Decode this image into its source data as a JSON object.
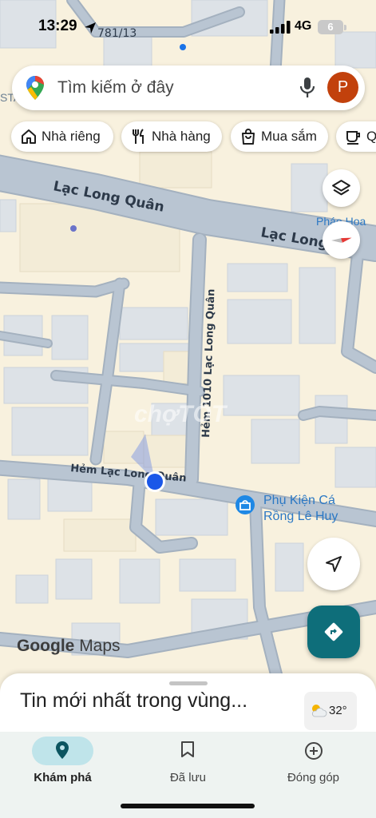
{
  "status_bar": {
    "time": "13:29",
    "network": "4G",
    "battery": "6"
  },
  "map": {
    "labels": {
      "street_top": "781/13",
      "road_main_left": "Lạc Long Quân",
      "road_main_right": "Lạc Long",
      "poi_top": "Pháo Hoa",
      "alley_vertical": "Hẻm 1010 Lạc Long Quân",
      "alley_horizontal": "Hẻm Lạc Long Quân",
      "poi_shop_line1": "Phụ Kiện Cá",
      "poi_shop_line2": "Rồng Lê Huy",
      "watermark": "chợTỐT",
      "edge_text_left": "STA"
    },
    "colors": {
      "land": "#f8f1de",
      "road": "#b6c2cf",
      "road_edge": "#a4b1bf",
      "building": "#dde2e7",
      "block": "#f3ecd7",
      "location_dot": "#1a73e8",
      "poi_blue": "#1e88e5",
      "compass_red": "#e53935",
      "directions_teal": "#0e6e7a"
    }
  },
  "search": {
    "placeholder": "Tìm kiếm ở đây",
    "avatar_letter": "P"
  },
  "chips": [
    {
      "label": "Nhà riêng",
      "icon": "home-icon"
    },
    {
      "label": "Nhà hàng",
      "icon": "restaurant-icon"
    },
    {
      "label": "Mua sắm",
      "icon": "shopping-bag-icon"
    },
    {
      "label": "Q",
      "icon": "coffee-icon"
    }
  ],
  "logo": {
    "google": "Google",
    "maps": "Maps"
  },
  "sheet": {
    "title": "Tin mới nhất trong vùng...",
    "temperature": "32°"
  },
  "nav": [
    {
      "label": "Khám phá",
      "icon": "explore-pin-icon",
      "active": true
    },
    {
      "label": "Đã lưu",
      "icon": "bookmark-icon",
      "active": false
    },
    {
      "label": "Đóng góp",
      "icon": "add-circle-icon",
      "active": false
    }
  ]
}
